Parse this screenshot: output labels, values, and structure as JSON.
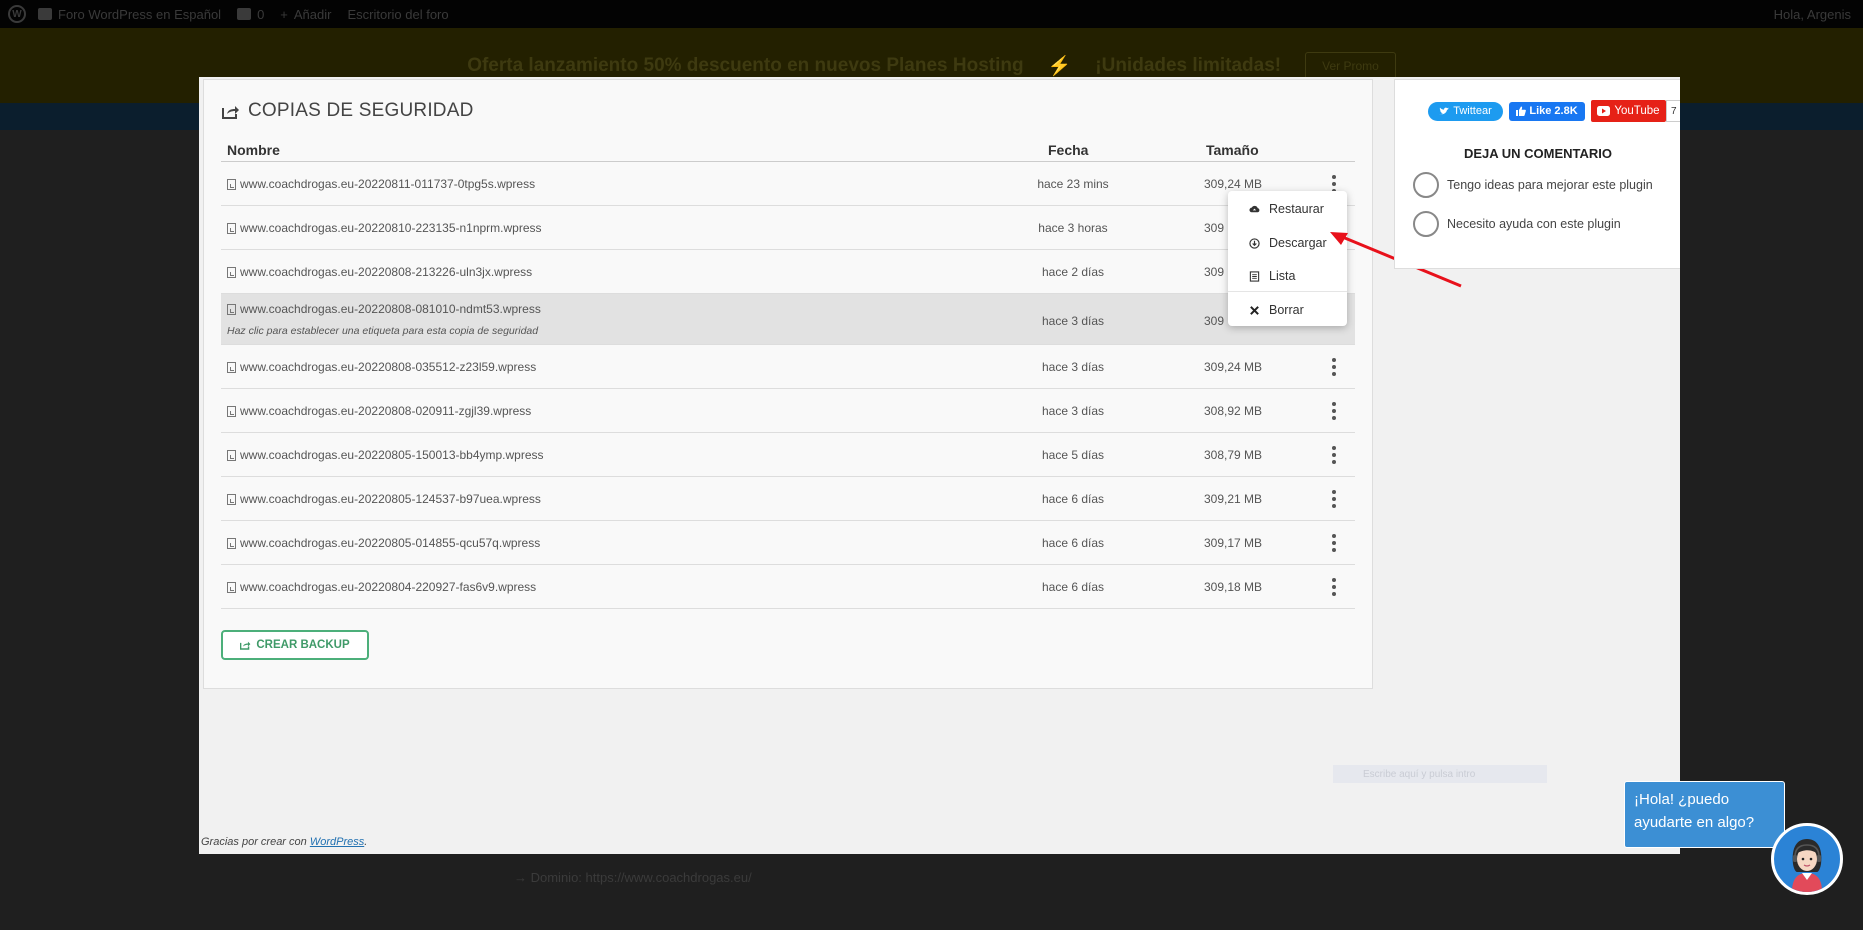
{
  "adminbar": {
    "site_name": "Foro WordPress en Español",
    "comments_count": "0",
    "add_label": "Añadir",
    "desk_label": "Escritorio del foro",
    "greeting": "Hola, Argenis"
  },
  "promo": {
    "text_left": "Oferta lanzamiento 50% descuento en nuevos Planes Hosting",
    "separator": "⚡",
    "text_right": "¡Unidades limitadas!",
    "button": "Ver Promo"
  },
  "panel": {
    "title": "COPIAS DE SEGURIDAD",
    "columns": {
      "name": "Nombre",
      "date": "Fecha",
      "size": "Tamaño"
    },
    "rows": [
      {
        "name": "www.coachdrogas.eu-20220811-011737-0tpg5s.wpress",
        "date": "hace 23 mins",
        "size": "309,24 MB"
      },
      {
        "name": "www.coachdrogas.eu-20220810-223135-n1nprm.wpress",
        "date": "hace 3 horas",
        "size": "309"
      },
      {
        "name": "www.coachdrogas.eu-20220808-213226-uln3jx.wpress",
        "date": "hace 2 días",
        "size": "309"
      },
      {
        "name": "www.coachdrogas.eu-20220808-081010-ndmt53.wpress",
        "date": "hace 3 días",
        "size": "309",
        "hint": "Haz clic para establecer una etiqueta para esta copia de seguridad"
      },
      {
        "name": "www.coachdrogas.eu-20220808-035512-z23l59.wpress",
        "date": "hace 3 días",
        "size": "309,24 MB"
      },
      {
        "name": "www.coachdrogas.eu-20220808-020911-zgjl39.wpress",
        "date": "hace 3 días",
        "size": "308,92 MB"
      },
      {
        "name": "www.coachdrogas.eu-20220805-150013-bb4ymp.wpress",
        "date": "hace 5 días",
        "size": "308,79 MB"
      },
      {
        "name": "www.coachdrogas.eu-20220805-124537-b97uea.wpress",
        "date": "hace 6 días",
        "size": "309,21 MB"
      },
      {
        "name": "www.coachdrogas.eu-20220805-014855-qcu57q.wpress",
        "date": "hace 6 días",
        "size": "309,17 MB"
      },
      {
        "name": "www.coachdrogas.eu-20220804-220927-fas6v9.wpress",
        "date": "hace 6 días",
        "size": "309,18 MB"
      }
    ],
    "create_button": "CREAR BACKUP"
  },
  "dropdown": {
    "items": [
      {
        "label": "Restaurar",
        "icon": "cloud-upload-icon"
      },
      {
        "label": "Descargar",
        "icon": "download-icon"
      },
      {
        "label": "Lista",
        "icon": "list-icon"
      },
      {
        "label": "Borrar",
        "icon": "close-icon"
      }
    ]
  },
  "sidebar": {
    "twitter": "Twittear",
    "facebook": "Like 2.8K",
    "youtube": "YouTube",
    "youtube_count": "7",
    "heading": "DEJA UN COMENTARIO",
    "options": [
      "Tengo ideas para mejorar este plugin",
      "Necesito ayuda con este plugin"
    ]
  },
  "footer": {
    "credit_prefix": "Gracias por crear con ",
    "credit_link": "WordPress",
    "credit_suffix": ".",
    "faded_search": "Escribe aquí y pulsa intro"
  },
  "dominio": "→ Dominio: https://www.coachdrogas.eu/",
  "chat": {
    "line1": "¡Hola! ¿puedo",
    "line2": "ayudarte en algo?"
  },
  "colors": {
    "accent_green": "#4caf7a",
    "arrow_red": "#e8111b",
    "chat_blue": "#3c8fd4"
  }
}
